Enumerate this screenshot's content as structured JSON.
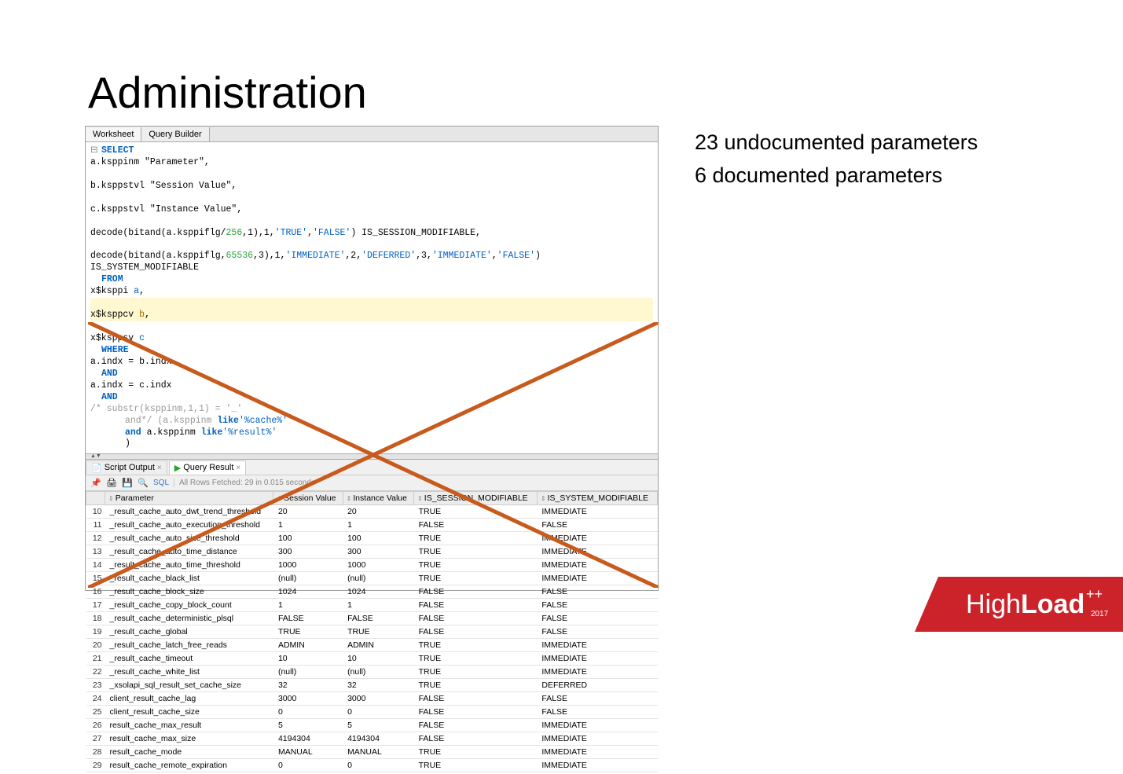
{
  "title": "Administration",
  "bullets": {
    "l1": "23 undocumented parameters",
    "l2": "6 documented parameters"
  },
  "tabs": {
    "worksheet": "Worksheet",
    "query_builder": "Query Builder"
  },
  "sql": {
    "line1": "a.ksppinm \"Parameter\",",
    "line2": "b.ksppstvl \"Session Value\",",
    "line3": "c.ksppstvl \"Instance Value\",",
    "line4a": "decode(bitand(a.ksppiflg/",
    "line4_num": "256",
    "line4b": ",1),1,",
    "line4_s1": "'TRUE'",
    "line4c": ",",
    "line4_s2": "'FALSE'",
    "line4d": ") IS_SESSION_MODIFIABLE,",
    "line5a": "decode(bitand(a.ksppiflg,",
    "line5_num": "65536",
    "line5b": ",3),1,",
    "line5_s1": "'IMMEDIATE'",
    "line5c": ",2,",
    "line5_s2": "'DEFERRED'",
    "line5d": ",3,",
    "line5_s3": "'IMMEDIATE'",
    "line5e": ",",
    "line5_s4": "'FALSE'",
    "line5f": ") IS_SYSTEM_MODIFIABLE",
    "from1": "x$ksppi ",
    "from1_a": "a",
    "from1_c": ",",
    "from2": "x$ksppcv ",
    "from2_a": "b",
    "from2_c": ",",
    "from3": "x$ksppsv ",
    "from3_a": "c",
    "where1": "a.indx = b.indx",
    "where2": "a.indx = c.indx",
    "where3_c": "/* substr(ksppinm,1,1) = '_'",
    "where4a": "and*/ (a.ksppinm ",
    "where4_kw": "like ",
    "where4_s": "'%cache%'",
    "where5a": "and",
    "where5b": " a.ksppinm ",
    "where5_kw": "like ",
    "where5_s": "'%result%'",
    "paren": ")"
  },
  "kw": {
    "select": "SELECT",
    "from": "FROM",
    "where": "WHERE",
    "and": "AND"
  },
  "bottom_tabs": {
    "script": "Script Output",
    "query": "Query Result"
  },
  "status": {
    "sql": "SQL",
    "fetched": "All Rows Fetched: 29 in 0.015 seconds"
  },
  "headers": {
    "param": "Parameter",
    "sess": "Session Value",
    "inst": "Instance Value",
    "sessmod": "IS_SESSION_MODIFIABLE",
    "sysmod": "IS_SYSTEM_MODIFIABLE"
  },
  "rows": [
    {
      "n": "10",
      "p": "_result_cache_auto_dwt_trend_threshold",
      "s": "20",
      "i": "20",
      "sm": "TRUE",
      "ym": "IMMEDIATE"
    },
    {
      "n": "11",
      "p": "_result_cache_auto_execution_threshold",
      "s": "1",
      "i": "1",
      "sm": "FALSE",
      "ym": "FALSE"
    },
    {
      "n": "12",
      "p": "_result_cache_auto_size_threshold",
      "s": "100",
      "i": "100",
      "sm": "TRUE",
      "ym": "IMMEDIATE"
    },
    {
      "n": "13",
      "p": "_result_cache_auto_time_distance",
      "s": "300",
      "i": "300",
      "sm": "TRUE",
      "ym": "IMMEDIATE"
    },
    {
      "n": "14",
      "p": "_result_cache_auto_time_threshold",
      "s": "1000",
      "i": "1000",
      "sm": "TRUE",
      "ym": "IMMEDIATE"
    },
    {
      "n": "15",
      "p": "_result_cache_black_list",
      "s": "(null)",
      "i": "(null)",
      "sm": "TRUE",
      "ym": "IMMEDIATE"
    },
    {
      "n": "16",
      "p": "_result_cache_block_size",
      "s": "1024",
      "i": "1024",
      "sm": "FALSE",
      "ym": "FALSE"
    },
    {
      "n": "17",
      "p": "_result_cache_copy_block_count",
      "s": "1",
      "i": "1",
      "sm": "FALSE",
      "ym": "FALSE"
    },
    {
      "n": "18",
      "p": "_result_cache_deterministic_plsql",
      "s": "FALSE",
      "i": "FALSE",
      "sm": "FALSE",
      "ym": "FALSE"
    },
    {
      "n": "19",
      "p": "_result_cache_global",
      "s": "TRUE",
      "i": "TRUE",
      "sm": "FALSE",
      "ym": "FALSE"
    },
    {
      "n": "20",
      "p": "_result_cache_latch_free_reads",
      "s": "ADMIN",
      "i": "ADMIN",
      "sm": "TRUE",
      "ym": "IMMEDIATE"
    },
    {
      "n": "21",
      "p": "_result_cache_timeout",
      "s": "10",
      "i": "10",
      "sm": "TRUE",
      "ym": "IMMEDIATE"
    },
    {
      "n": "22",
      "p": "_result_cache_white_list",
      "s": "(null)",
      "i": "(null)",
      "sm": "TRUE",
      "ym": "IMMEDIATE"
    },
    {
      "n": "23",
      "p": "_xsolapi_sql_result_set_cache_size",
      "s": "32",
      "i": "32",
      "sm": "TRUE",
      "ym": "DEFERRED"
    },
    {
      "n": "24",
      "p": "client_result_cache_lag",
      "s": "3000",
      "i": "3000",
      "sm": "FALSE",
      "ym": "FALSE"
    },
    {
      "n": "25",
      "p": "client_result_cache_size",
      "s": "0",
      "i": "0",
      "sm": "FALSE",
      "ym": "FALSE"
    },
    {
      "n": "26",
      "p": "result_cache_max_result",
      "s": "5",
      "i": "5",
      "sm": "FALSE",
      "ym": "IMMEDIATE"
    },
    {
      "n": "27",
      "p": "result_cache_max_size",
      "s": "4194304",
      "i": "4194304",
      "sm": "FALSE",
      "ym": "IMMEDIATE"
    },
    {
      "n": "28",
      "p": "result_cache_mode",
      "s": "MANUAL",
      "i": "MANUAL",
      "sm": "TRUE",
      "ym": "IMMEDIATE"
    },
    {
      "n": "29",
      "p": "result_cache_remote_expiration",
      "s": "0",
      "i": "0",
      "sm": "TRUE",
      "ym": "IMMEDIATE"
    }
  ],
  "logo": {
    "t1": "High",
    "t2": "Load",
    "t3": "++",
    "year": "2017"
  }
}
